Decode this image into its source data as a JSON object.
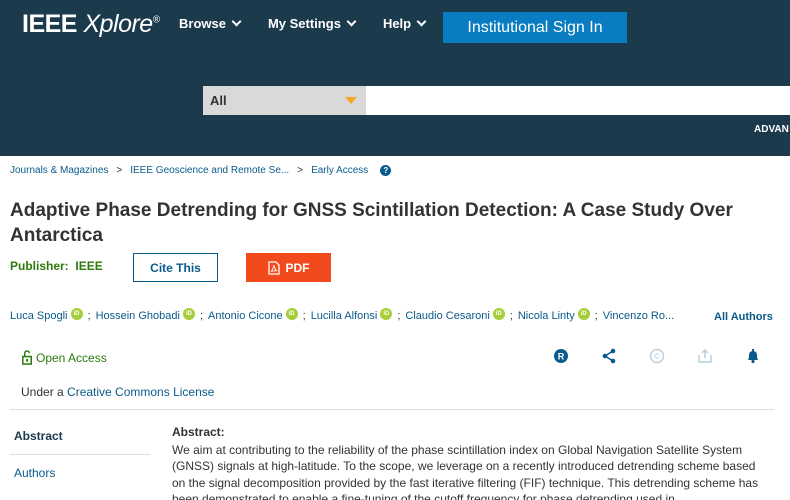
{
  "header": {
    "logo_main": "IEEE",
    "logo_sub": "Xplore",
    "logo_reg": "®",
    "nav": [
      {
        "label": "Browse"
      },
      {
        "label": "My Settings"
      },
      {
        "label": "Help"
      }
    ],
    "signin_label": "Institutional Sign In",
    "search": {
      "scope_selected": "All",
      "placeholder": ""
    },
    "advanced_label": "ADVAN"
  },
  "breadcrumb": {
    "items": [
      "Journals & Magazines",
      "IEEE Geoscience and Remote Se...",
      "Early Access"
    ],
    "separator": ">",
    "help": "?"
  },
  "article": {
    "title": "Adaptive Phase Detrending for GNSS Scintillation Detection: A Case Study Over Antarctica",
    "publisher_label": "Publisher:",
    "publisher_value": "IEEE",
    "cite_label": "Cite This",
    "pdf_label": "PDF",
    "authors": [
      "Luca Spogli",
      "Hossein Ghobadi",
      "Antonio Cicone",
      "Lucilla Alfonsi",
      "Claudio Cesaroni",
      "Nicola Linty",
      "Vincenzo Ro..."
    ],
    "author_separator": ";",
    "orcid_label": "iD",
    "all_authors_label": "All Authors",
    "open_access_label": "Open Access",
    "license_prefix": "Under a ",
    "license_link": "Creative Commons License",
    "rights_glyph": "R",
    "copyright_glyph": "©"
  },
  "sidenav": {
    "items": [
      {
        "label": "Abstract"
      },
      {
        "label": "Authors"
      }
    ]
  },
  "abstract": {
    "heading": "Abstract:",
    "text": "We aim at contributing to the reliability of the phase scintillation index on Global Navigation Satellite System (GNSS) signals at high-latitude. To the scope, we leverage on a recently introduced detrending scheme based on the signal decomposition provided by the fast iterative filtering (FIF) technique. This detrending scheme has been demonstrated to enable a fine-tuning of the cutoff frequency for phase detrending used in"
  },
  "colors": {
    "header_bg": "#1b3a4b",
    "signin_bg": "#0a7cc1",
    "link": "#0a5a8c",
    "publisher": "#2b7a0b",
    "pdf_bg": "#f24a1d",
    "orcid": "#a6ce39",
    "search_arrow": "#f5a623"
  }
}
